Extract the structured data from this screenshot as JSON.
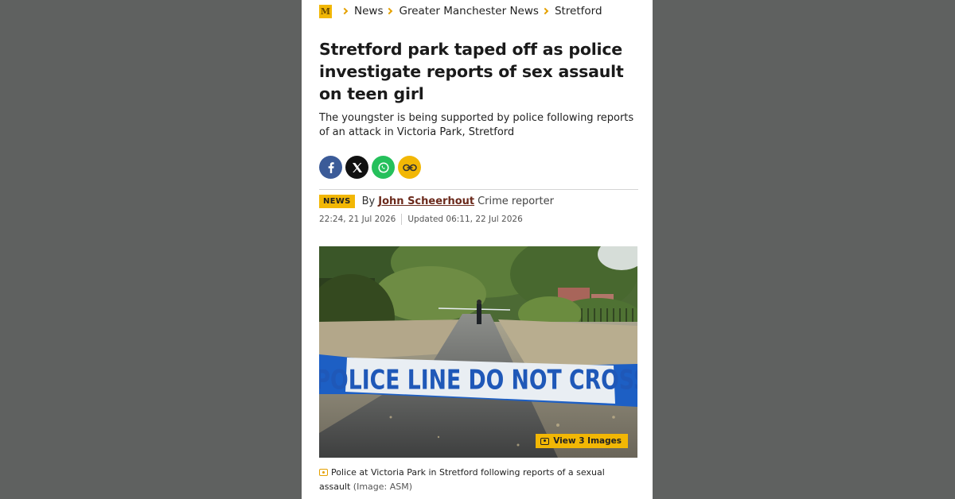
{
  "breadcrumb": {
    "logo_letter": "M",
    "items": [
      "News",
      "Greater Manchester News",
      "Stretford"
    ]
  },
  "article": {
    "headline": "Stretford park taped off as police investigate reports of sex assault on teen girl",
    "standfirst": "The youngster is being supported by police following reports of an attack in Victoria Park, Stretford",
    "badge": "NEWS",
    "by_prefix": "By",
    "author": "John Scheerhout",
    "role": "Crime reporter",
    "published": "22:24, 21 Jul 2026",
    "updated": "Updated 06:11, 22 Jul 2026"
  },
  "share": {
    "icons": [
      "facebook-icon",
      "x-twitter-icon",
      "whatsapp-icon",
      "copy-link-icon"
    ]
  },
  "image": {
    "tape_text": "POLICE LINE DO NOT CROSS",
    "view_images_label": "View 3 Images",
    "caption": "Police at Victoria Park in Stretford following reports of a sexual assault",
    "credit": "(Image: ASM)"
  },
  "colors": {
    "background": "#5f6160",
    "accent": "#f2b705",
    "author_link": "#6b2a1c",
    "facebook": "#3b5b98",
    "whatsapp": "#25c05b"
  }
}
